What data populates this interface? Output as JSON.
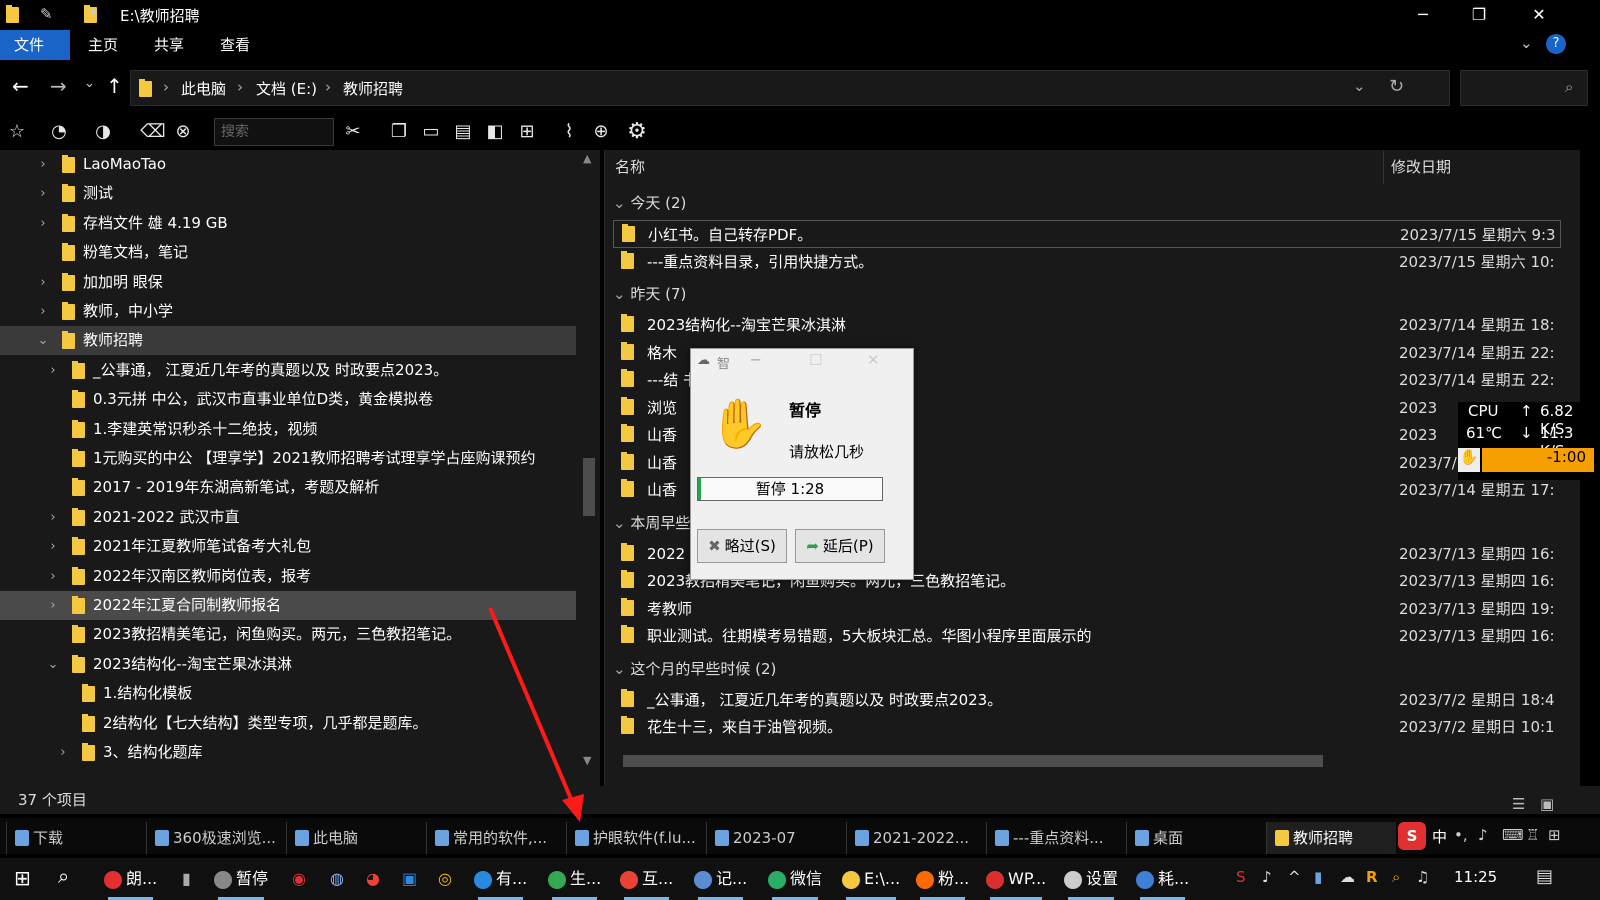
{
  "window": {
    "title": "E:\\教师招聘",
    "minimize": "─",
    "maximize": "❐",
    "close": "✕"
  },
  "ribbon": {
    "tabs": [
      "文件",
      "主页",
      "共享",
      "查看"
    ],
    "help": "?"
  },
  "address": {
    "crumbs": [
      "此电脑",
      "文档 (E:)",
      "教师招聘"
    ],
    "sep": "›"
  },
  "toolbar": {
    "search_placeholder": "搜索"
  },
  "nav": {
    "items": [
      {
        "label": "LaoMaoTao",
        "indent": 0,
        "chev": "›"
      },
      {
        "label": "测试",
        "indent": 0,
        "chev": "›"
      },
      {
        "label": "存档文件 雄 4.19 GB",
        "indent": 0,
        "chev": "›"
      },
      {
        "label": "粉笔文档，笔记",
        "indent": 0,
        "chev": ""
      },
      {
        "label": "加加明 眼保",
        "indent": 0,
        "chev": "›"
      },
      {
        "label": "教师，中小学",
        "indent": 0,
        "chev": "›"
      },
      {
        "label": "教师招聘",
        "indent": 0,
        "chev": "⌄",
        "state": "sel"
      },
      {
        "label": "_公事通， 江夏近几年考的真题以及 时政要点2023。",
        "indent": 1,
        "chev": "›"
      },
      {
        "label": "0.3元拼 中公，武汉市直事业单位D类，黄金模拟卷",
        "indent": 1,
        "chev": ""
      },
      {
        "label": "1.李建英常识秒杀十二绝技，视频",
        "indent": 1,
        "chev": ""
      },
      {
        "label": "1元购买的中公 【理享学】2021教师招聘考试理享学占座购课预约",
        "indent": 1,
        "chev": ""
      },
      {
        "label": "2017 - 2019年东湖高新笔试，考题及解析",
        "indent": 1,
        "chev": ""
      },
      {
        "label": "2021-2022 武汉市直",
        "indent": 1,
        "chev": "›"
      },
      {
        "label": "2021年江夏教师笔试备考大礼包",
        "indent": 1,
        "chev": "›"
      },
      {
        "label": "2022年汉南区教师岗位表，报考",
        "indent": 1,
        "chev": "›"
      },
      {
        "label": "2022年江夏合同制教师报名",
        "indent": 1,
        "chev": "›",
        "state": "hov"
      },
      {
        "label": "2023教招精美笔记，闲鱼购买。两元，三色教招笔记。",
        "indent": 1,
        "chev": ""
      },
      {
        "label": "2023结构化--淘宝芒果冰淇淋",
        "indent": 1,
        "chev": "⌄"
      },
      {
        "label": "1.结构化模板",
        "indent": 2,
        "chev": ""
      },
      {
        "label": "2结构化【七大结构】类型专项，几乎都是题库。",
        "indent": 2,
        "chev": ""
      },
      {
        "label": "3、结构化题库",
        "indent": 2,
        "chev": "›"
      }
    ]
  },
  "files": {
    "col_name": "名称",
    "col_date": "修改日期",
    "groups": [
      {
        "title": "今天 (2)",
        "rows": [
          {
            "name": "小红书。自己转存PDF。",
            "date": "2023/7/15 星期六 9:3",
            "sel": true
          },
          {
            "name": "---重点资料目录，引用快捷方式。",
            "date": "2023/7/15 星期六 10:"
          }
        ]
      },
      {
        "title": "昨天 (7)",
        "rows": [
          {
            "name": "2023结构化--淘宝芒果冰淇淋",
            "date": "2023/7/14 星期五 18:"
          },
          {
            "name": "格木",
            "date": "2023/7/14 星期五 22:"
          },
          {
            "name": "---结                               书网友分享。",
            "date": "2023/7/14 星期五 22:"
          },
          {
            "name": "浏览",
            "date": "2023"
          },
          {
            "name": "山香",
            "date": "2023"
          },
          {
            "name": "山香",
            "date": "2023/7/"
          },
          {
            "name": "山香",
            "date": "2023/7/14 星期五 17:"
          }
        ]
      },
      {
        "title": "本周早些",
        "rows": [
          {
            "name": "2022",
            "date": "2023/7/13 星期四 16:"
          },
          {
            "name": "2023教招精美笔记，闲鱼购买。两元，三色教招笔记。",
            "date": "2023/7/13 星期四 16:"
          },
          {
            "name": "考教师",
            "date": "2023/7/13 星期四 19:"
          },
          {
            "name": "职业测试。往期模考易错题，5大板块汇总。华图小程序里面展示的",
            "date": "2023/7/13 星期四 16:"
          }
        ]
      },
      {
        "title": "这个月的早些时候 (2)",
        "rows": [
          {
            "name": "_公事通， 江夏近几年考的真题以及 时政要点2023。",
            "date": "2023/7/2 星期日 18:4"
          },
          {
            "name": "花生十三，来自于油管视频。",
            "date": "2023/7/2 星期日 10:1"
          }
        ]
      }
    ]
  },
  "status": {
    "count": "37 个项目"
  },
  "dialog": {
    "title_char": "智",
    "heading": "暂停",
    "message": "请放松几秒",
    "countdown": "暂停 1:28",
    "skip": "略过(S)",
    "delay": "延后(P)"
  },
  "widget": {
    "cpu_label": "CPU",
    "temp": "61℃",
    "up": "6.82 K/S",
    "down": "11.3 K/S",
    "timer": "-1:00",
    "timer_color": "#f5a000"
  },
  "tabs_row": [
    {
      "label": "下载"
    },
    {
      "label": "360极速浏览..."
    },
    {
      "label": "此电脑"
    },
    {
      "label": "常用的软件,..."
    },
    {
      "label": "护眼软件(f.lu..."
    },
    {
      "label": "2023-07"
    },
    {
      "label": "2021-2022..."
    },
    {
      "label": "---重点资料..."
    },
    {
      "label": "桌面"
    },
    {
      "label": "教师招聘",
      "active": true
    }
  ],
  "taskbar": {
    "items": [
      {
        "label": "朗...",
        "color": "#e03030"
      },
      {
        "label": "暂停",
        "color": "#888888"
      },
      {
        "label": "有...",
        "color": "#2a8adf"
      },
      {
        "label": "生...",
        "color": "#34a853"
      },
      {
        "label": "互...",
        "color": "#ea4335"
      },
      {
        "label": "记...",
        "color": "#5b8dd6"
      },
      {
        "label": "微信",
        "color": "#2aae67"
      },
      {
        "label": "E:\\...",
        "color": "#f5c842"
      },
      {
        "label": "粉...",
        "color": "#ff6a00"
      },
      {
        "label": "WP...",
        "color": "#d9302f"
      },
      {
        "label": "设置",
        "color": "#cccccc"
      },
      {
        "label": "耗...",
        "color": "#3f7fd6"
      }
    ],
    "tray_ime": "中",
    "clock": "11:25"
  }
}
